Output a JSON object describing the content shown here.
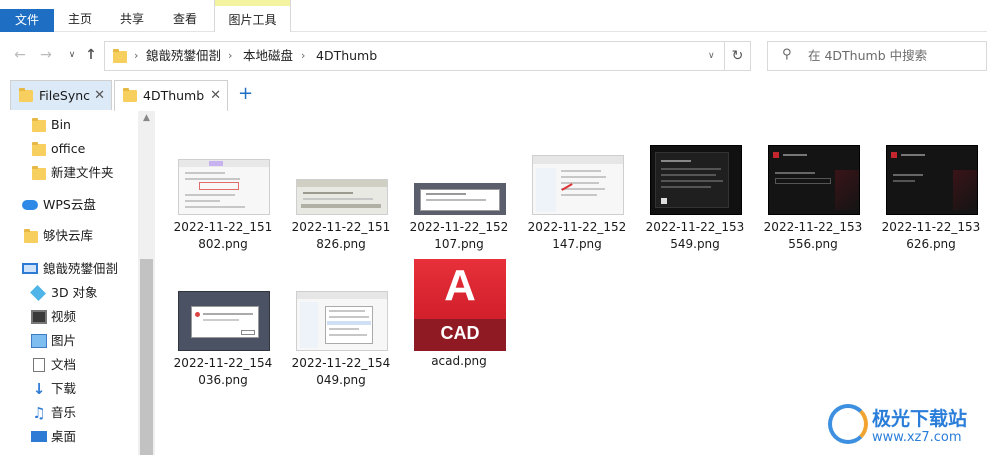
{
  "ribbon": {
    "tabs": [
      "文件",
      "主页",
      "共享",
      "查看",
      "图片工具"
    ]
  },
  "nav": {
    "back_icon": "arrow-left-icon",
    "forward_icon": "arrow-right-icon",
    "recent_icon": "chevron-down-icon",
    "up_icon": "arrow-up-icon",
    "breadcrumb": [
      "鎴戠殑鐢佃剳",
      "本地磁盘",
      "4DThumb"
    ],
    "search_placeholder": "在 4DThumb 中搜索"
  },
  "doc_tabs": [
    {
      "label": "FileSync",
      "active": false
    },
    {
      "label": "4DThumb",
      "active": true
    }
  ],
  "sidebar": {
    "items": [
      {
        "label": "Bin",
        "icon": "folder-icon"
      },
      {
        "label": "office",
        "icon": "folder-icon"
      },
      {
        "label": "新建文件夹",
        "icon": "folder-icon"
      },
      {
        "label": "WPS云盘",
        "icon": "cloud-icon"
      },
      {
        "label": "够快云库",
        "icon": "folder-icon"
      },
      {
        "label": "鎴戠殑鐢佃剳",
        "icon": "computer-icon"
      },
      {
        "label": "3D 对象",
        "icon": "cube-icon"
      },
      {
        "label": "视频",
        "icon": "video-icon"
      },
      {
        "label": "图片",
        "icon": "picture-icon"
      },
      {
        "label": "文档",
        "icon": "document-icon"
      },
      {
        "label": "下载",
        "icon": "download-icon"
      },
      {
        "label": "音乐",
        "icon": "music-icon"
      },
      {
        "label": "桌面",
        "icon": "desktop-icon"
      }
    ]
  },
  "files": [
    {
      "name": "2022-11-22_151802.png",
      "line1": "2022-11-22_151",
      "line2": "802.png",
      "kind": "window"
    },
    {
      "name": "2022-11-22_151826.png",
      "line1": "2022-11-22_151",
      "line2": "826.png",
      "kind": "dialog-light"
    },
    {
      "name": "2022-11-22_152107.png",
      "line1": "2022-11-22_152",
      "line2": "107.png",
      "kind": "dialog-gray"
    },
    {
      "name": "2022-11-22_152147.png",
      "line1": "2022-11-22_152",
      "line2": "147.png",
      "kind": "explorer"
    },
    {
      "name": "2022-11-22_153549.png",
      "line1": "2022-11-22_153",
      "line2": "549.png",
      "kind": "dark-license"
    },
    {
      "name": "2022-11-22_153556.png",
      "line1": "2022-11-22_153",
      "line2": "556.png",
      "kind": "dark-installer"
    },
    {
      "name": "2022-11-22_153626.png",
      "line1": "2022-11-22_153",
      "line2": "626.png",
      "kind": "dark-installer"
    },
    {
      "name": "2022-11-22_154036.png",
      "line1": "2022-11-22_154",
      "line2": "036.png",
      "kind": "gray-alert"
    },
    {
      "name": "2022-11-22_154049.png",
      "line1": "2022-11-22_154",
      "line2": "049.png",
      "kind": "context-menu"
    },
    {
      "name": "acad.png",
      "line1": "acad.png",
      "line2": "",
      "kind": "autocad-icon",
      "icon_letter": "A",
      "icon_text": "CAD"
    }
  ],
  "watermark": {
    "title": "极光下载站",
    "url": "www.xz7.com"
  },
  "colors": {
    "accent": "#1e6fc4",
    "folder": "#f6cf5f",
    "autocad_red": "#d11f2b"
  }
}
